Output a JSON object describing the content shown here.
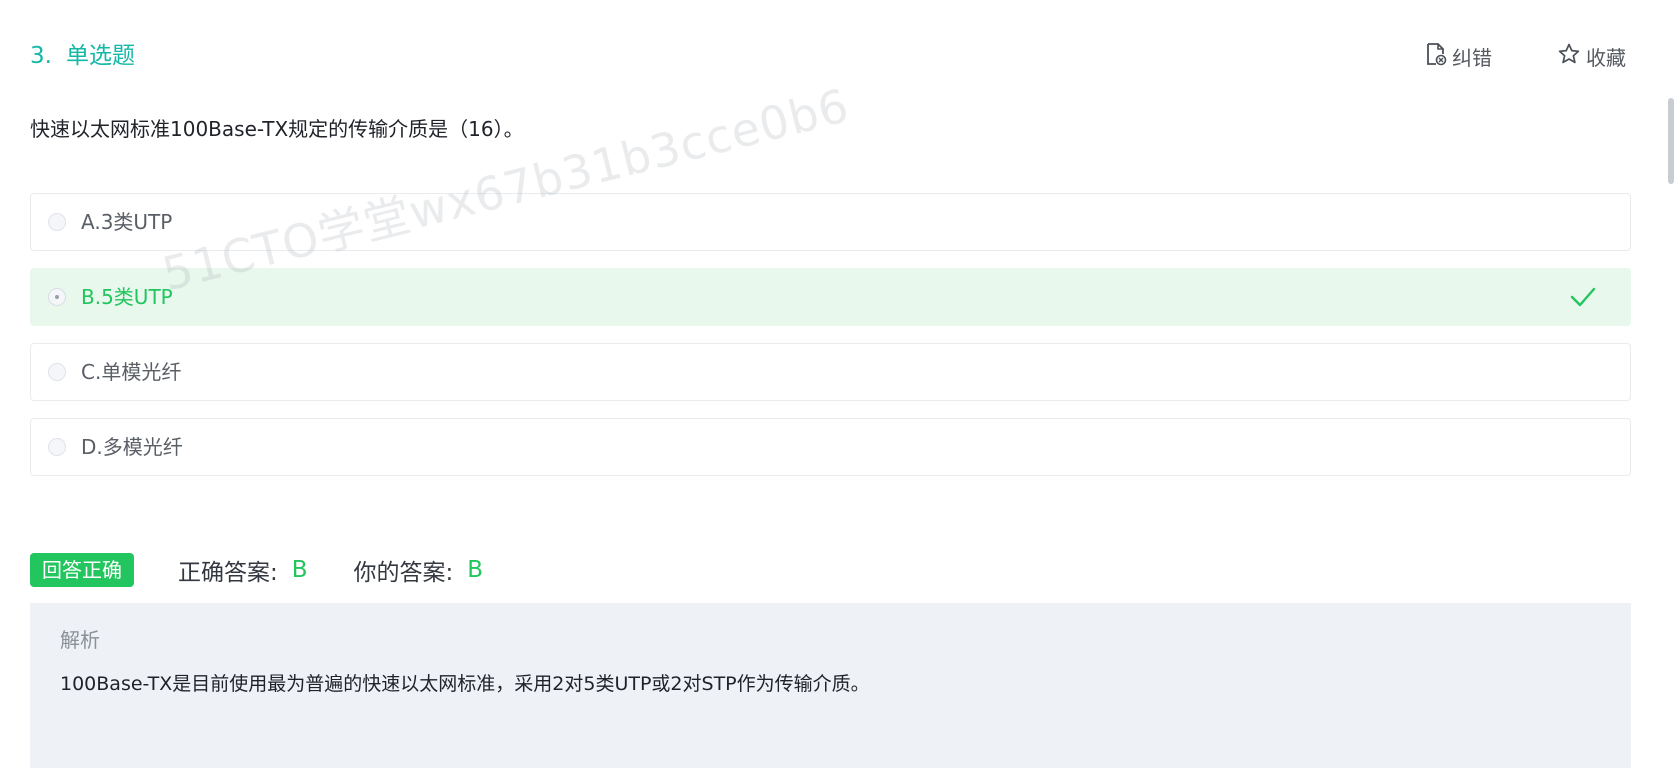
{
  "question": {
    "number": "3.",
    "type": "单选题",
    "stem": "快速以太网标准100Base-TX规定的传输介质是（16）。"
  },
  "toolbar": {
    "report_label": "纠错",
    "favorite_label": "收藏",
    "report_icon": "document-edit-icon",
    "favorite_icon": "star-icon"
  },
  "options": [
    {
      "label": "A.3类UTP",
      "selected": false
    },
    {
      "label": "B.5类UTP",
      "selected": true,
      "correct": true
    },
    {
      "label": "C.单模光纤",
      "selected": false
    },
    {
      "label": "D.多模光纤",
      "selected": false
    }
  ],
  "watermark": "51CTO学堂wx67b31b3cce0b6",
  "result": {
    "badge": "回答正确",
    "correct_answer_label": "正确答案:",
    "correct_answer": "B",
    "your_answer_label": "你的答案:",
    "your_answer": "B"
  },
  "analysis": {
    "title": "解析",
    "body": "100Base-TX是目前使用最为普遍的快速以太网标准，采用2对5类UTP或2对STP作为传输介质。"
  },
  "colors": {
    "accent": "#14b8a6",
    "success": "#22c55e",
    "selected_bg": "#e8f8ec",
    "analysis_bg": "#eef1f5"
  }
}
